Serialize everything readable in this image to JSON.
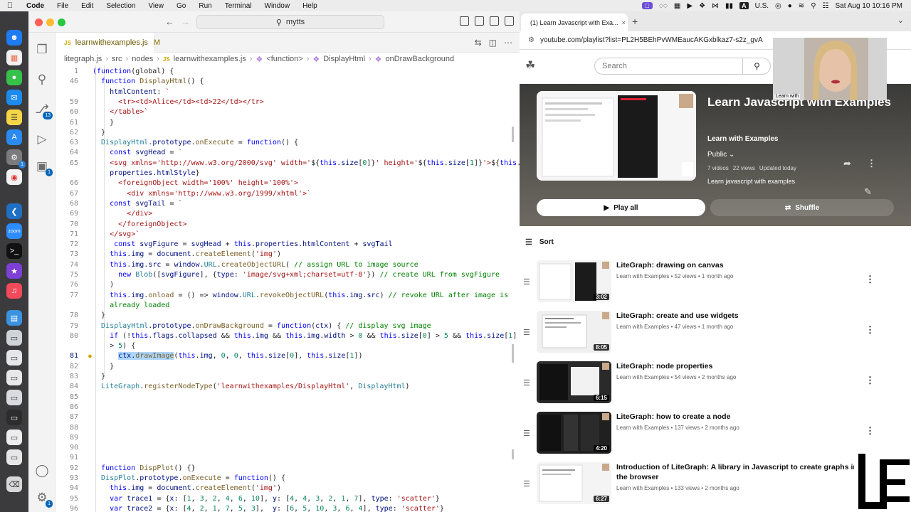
{
  "menubar": {
    "app": "Code",
    "items": [
      "File",
      "Edit",
      "Selection",
      "View",
      "Go",
      "Run",
      "Terminal",
      "Window",
      "Help"
    ],
    "input_source": "U.S.",
    "clock": "Sat Aug 10  10:16 PM"
  },
  "dock": {
    "badge_mail": "13",
    "badge_settings": "1"
  },
  "vscode": {
    "search": "mytts",
    "tab_label": "learnwithexamples.js",
    "tab_modified": "M",
    "tab_js": "JS",
    "activity_badge": "1",
    "breadcrumb": [
      "litegraph.js",
      "src",
      "nodes",
      "learnwithexamples.js",
      "<function>",
      "DisplayHtml",
      "onDrawBackground"
    ],
    "lines": [
      {
        "n": "1",
        "html": "<span class=\"kw\">(function</span>(global) {"
      },
      {
        "n": "46",
        "html": "  <span class=\"kw\">function</span> <span class=\"fn\">DisplayHtml</span>() {"
      },
      {
        "n": "",
        "html": "    <span class=\"prop\">htmlContent</span>: <span class=\"str\">`</span>"
      },
      {
        "n": "59",
        "html": "      <span class=\"str\">&lt;tr&gt;&lt;td&gt;Alice&lt;/td&gt;&lt;td&gt;22&lt;/td&gt;&lt;/tr&gt;</span>"
      },
      {
        "n": "60",
        "html": "    <span class=\"str\">&lt;/table&gt;`</span>"
      },
      {
        "n": "61",
        "html": "    }"
      },
      {
        "n": "62",
        "html": "  }"
      },
      {
        "n": "63",
        "html": "  <span class=\"tp\">DisplayHtml</span>.<span class=\"prop\">prototype</span>.<span class=\"fn\">onExecute</span> = <span class=\"kw\">function</span>() {"
      },
      {
        "n": "64",
        "html": "    <span class=\"kw\">const</span> <span class=\"prop\">svgHead</span> = <span class=\"str\">`</span>"
      },
      {
        "n": "65",
        "html": "    <span class=\"str\">&lt;svg xmlns='http://www.w3.org/2000/svg' width='</span>${<span class=\"kw\">this</span>.<span class=\"prop\">size</span>[<span class=\"num\">0</span>]}<span class=\"str\">' height='</span>${<span class=\"kw\">this</span>.<span class=\"prop\">size</span>[<span class=\"num\">1</span>]}<span class=\"str\">'&gt;</span>${<span class=\"kw\">this</span>."
      },
      {
        "n": "",
        "html": "    <span class=\"prop\">properties</span>.<span class=\"prop\">htmlStyle</span>}"
      },
      {
        "n": "66",
        "html": "      <span class=\"str\">&lt;foreignObject width='100%' height='100%'&gt;</span>"
      },
      {
        "n": "67",
        "html": "        <span class=\"str\">&lt;div xmlns='http://www.w3.org/1999/xhtml'&gt;`</span>"
      },
      {
        "n": "68",
        "html": "    <span class=\"kw\">const</span> <span class=\"prop\">svgTail</span> = <span class=\"str\">`</span>"
      },
      {
        "n": "69",
        "html": "        <span class=\"str\">&lt;/div&gt;</span>"
      },
      {
        "n": "70",
        "html": "      <span class=\"str\">&lt;/foreignObject&gt;</span>"
      },
      {
        "n": "71",
        "html": "    <span class=\"str\">&lt;/svg&gt;`</span>"
      },
      {
        "n": "72",
        "html": "     <span class=\"kw\">const</span> <span class=\"prop\">svgFigure</span> = <span class=\"prop\">svgHead</span> + <span class=\"kw\">this</span>.<span class=\"prop\">properties</span>.<span class=\"prop\">htmlContent</span> + <span class=\"prop\">svgTail</span>"
      },
      {
        "n": "73",
        "html": "    <span class=\"kw\">this</span>.<span class=\"prop\">img</span> = <span class=\"prop\">document</span>.<span class=\"fn\">createElement</span>(<span class=\"str\">'img'</span>)"
      },
      {
        "n": "74",
        "html": "    <span class=\"kw\">this</span>.<span class=\"prop\">img</span>.<span class=\"prop\">src</span> = <span class=\"prop\">window</span>.<span class=\"tp\">URL</span>.<span class=\"fn\">createObjectURL</span>( <span class=\"cm\">// assign URL to image source</span>"
      },
      {
        "n": "75",
        "html": "      <span class=\"kw\">new</span> <span class=\"tp\">Blob</span>([<span class=\"prop\">svgFigure</span>], {<span class=\"prop\">type</span>: <span class=\"str\">'image/svg+xml;charset=utf-8'</span>}) <span class=\"cm\">// create URL from svgFigure</span>"
      },
      {
        "n": "76",
        "html": "    )"
      },
      {
        "n": "77",
        "html": "    <span class=\"kw\">this</span>.<span class=\"prop\">img</span>.<span class=\"fn\">onload</span> = () =&gt; <span class=\"prop\">window</span>.<span class=\"tp\">URL</span>.<span class=\"fn\">revokeObjectURL</span>(<span class=\"kw\">this</span>.<span class=\"prop\">img</span>.<span class=\"prop\">src</span>) <span class=\"cm\">// revoke URL after image is</span>"
      },
      {
        "n": "",
        "html": "    <span class=\"cm\">already loaded</span>"
      },
      {
        "n": "78",
        "html": "  }"
      },
      {
        "n": "79",
        "html": "  <span class=\"tp\">DisplayHtml</span>.<span class=\"prop\">prototype</span>.<span class=\"fn\">onDrawBackground</span> = <span class=\"kw\">function</span>(<span class=\"prop\">ctx</span>) { <span class=\"cm\">// display svg image</span>"
      },
      {
        "n": "80",
        "html": "    <span class=\"kw\">if</span> (!<span class=\"kw\">this</span>.<span class=\"prop\">flags</span>.<span class=\"prop\">collapsed</span> &amp;&amp; <span class=\"kw\">this</span>.<span class=\"prop\">img</span> &amp;&amp; <span class=\"kw\">this</span>.<span class=\"prop\">img</span>.<span class=\"prop\">width</span> &gt; <span class=\"num\">0</span> &amp;&amp; <span class=\"kw\">this</span>.<span class=\"prop\">size</span>[<span class=\"num\">0</span>] &gt; <span class=\"num\">5</span> &amp;&amp; <span class=\"kw\">this</span>.<span class=\"prop\">size</span>[<span class=\"num\">1</span>]"
      },
      {
        "n": "",
        "html": "    &gt; <span class=\"num\">5</span>) {"
      },
      {
        "n": "81",
        "html": "      <span class=\"sel\"><span class=\"prop\">ctx</span>.<span class=\"fn\">drawImage</span></span>(<span class=\"kw\">this</span>.<span class=\"prop\">img</span>, <span class=\"num\">0</span>, <span class=\"num\">0</span>, <span class=\"kw\">this</span>.<span class=\"prop\">size</span>[<span class=\"num\">0</span>], <span class=\"kw\">this</span>.<span class=\"prop\">size</span>[<span class=\"num\">1</span>])",
        "active": true
      },
      {
        "n": "82",
        "html": "    }"
      },
      {
        "n": "83",
        "html": "  }"
      },
      {
        "n": "84",
        "html": "  <span class=\"tp\">LiteGraph</span>.<span class=\"fn\">registerNodeType</span>(<span class=\"str\">'learnwithexamples/DisplayHtml'</span>, <span class=\"tp\">DisplayHtml</span>)"
      },
      {
        "n": "85",
        "html": ""
      },
      {
        "n": "86",
        "html": ""
      },
      {
        "n": "87",
        "html": ""
      },
      {
        "n": "88",
        "html": ""
      },
      {
        "n": "89",
        "html": ""
      },
      {
        "n": "90",
        "html": ""
      },
      {
        "n": "91",
        "html": ""
      },
      {
        "n": "92",
        "html": "  <span class=\"kw\">function</span> <span class=\"fn\">DispPlot</span>() {}"
      },
      {
        "n": "93",
        "html": "  <span class=\"tp\">DispPlot</span>.<span class=\"prop\">prototype</span>.<span class=\"fn\">onExecute</span> = <span class=\"kw\">function</span>() {"
      },
      {
        "n": "94",
        "html": "    <span class=\"kw\">this</span>.<span class=\"prop\">img</span> = <span class=\"prop\">document</span>.<span class=\"fn\">createElement</span>(<span class=\"str\">'img'</span>)"
      },
      {
        "n": "95",
        "html": "    <span class=\"kw\">var</span> <span class=\"prop\">trace1</span> = {<span class=\"prop\">x</span>: [<span class=\"num\">1</span>, <span class=\"num\">3</span>, <span class=\"num\">2</span>, <span class=\"num\">4</span>, <span class=\"num\">6</span>, <span class=\"num\">10</span>], <span class=\"prop\">y</span>: [<span class=\"num\">4</span>, <span class=\"num\">4</span>, <span class=\"num\">3</span>, <span class=\"num\">2</span>, <span class=\"num\">1</span>, <span class=\"num\">7</span>], <span class=\"prop\">type</span>: <span class=\"str\">'scatter'</span>}"
      },
      {
        "n": "96",
        "html": "    <span class=\"kw\">var</span> <span class=\"prop\">trace2</span> = {<span class=\"prop\">x</span>: [<span class=\"num\">4</span>, <span class=\"num\">2</span>, <span class=\"num\">1</span>, <span class=\"num\">7</span>, <span class=\"num\">5</span>, <span class=\"num\">3</span>],  <span class=\"prop\">y</span>: [<span class=\"num\">6</span>, <span class=\"num\">5</span>, <span class=\"num\">10</span>, <span class=\"num\">3</span>, <span class=\"num\">6</span>, <span class=\"num\">4</span>], <span class=\"prop\">type</span>: <span class=\"str\">'scatter'</span>}"
      }
    ]
  },
  "browser": {
    "tab_title": "(1) Learn Javascript with Exa...",
    "url": "youtube.com/playlist?list=PL2H5BEhPvWMEaucAKGxblkaz7-s2z_gvA",
    "search_placeholder": "Search",
    "playlist": {
      "title": "Learn Javascript with Examples",
      "channel": "Learn with Examples",
      "visibility": "Public",
      "stats": [
        "7 videos",
        "22 views",
        "Updated today"
      ],
      "description": "Learn javascript with examples",
      "play_all": "Play all",
      "shuffle": "Shuffle"
    },
    "sort_label": "Sort",
    "webcam_label": "Learn with",
    "videos": [
      {
        "title": "LiteGraph: drawing on canvas",
        "meta": "Learn with Examples • 52 views • 1 month ago",
        "duration": "3:02"
      },
      {
        "title": "LiteGraph: create and use widgets",
        "meta": "Learn with Examples • 47 views • 1 month ago",
        "duration": "8:05"
      },
      {
        "title": "LiteGraph: node properties",
        "meta": "Learn with Examples • 54 views • 2 months ago",
        "duration": "6:15"
      },
      {
        "title": "LiteGraph: how to create a node",
        "meta": "Learn with Examples • 137 views • 2 months ago",
        "duration": "4:20"
      },
      {
        "title": "Introduction of LiteGraph: A library in Javascript to create graphs in the browser",
        "meta": "Learn with Examples • 133 views • 2 months ago",
        "duration": "6:27"
      }
    ]
  }
}
